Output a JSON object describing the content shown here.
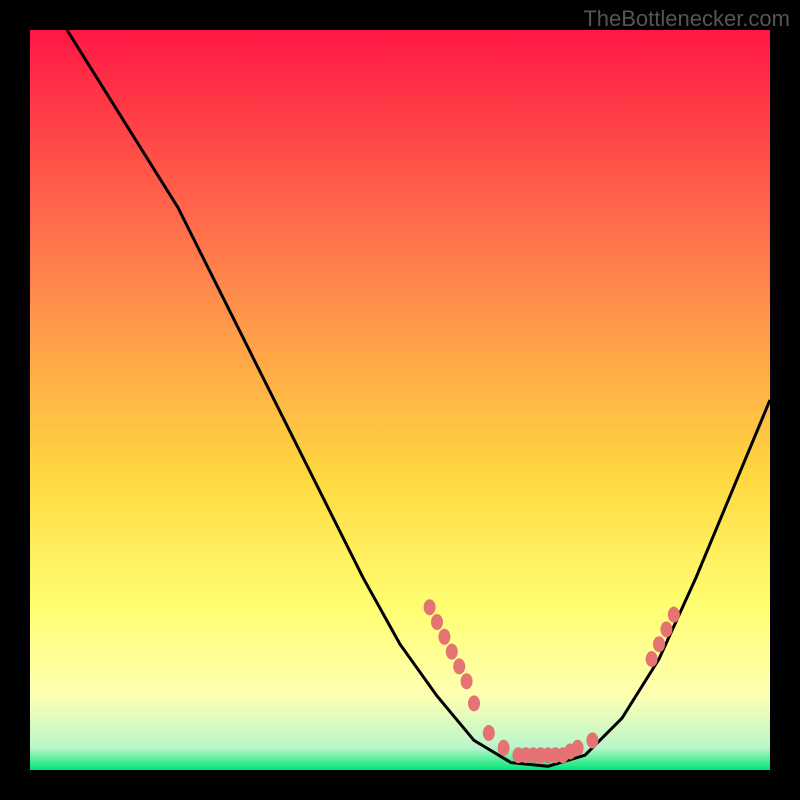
{
  "watermark": "TheBottlenecker.com",
  "chart_data": {
    "type": "line",
    "title": "",
    "xlabel": "",
    "ylabel": "",
    "xlim": [
      0,
      100
    ],
    "ylim": [
      0,
      100
    ],
    "gradient": {
      "top": "#ff1744",
      "mid_upper": "#ff8a65",
      "mid": "#ffeb3b",
      "mid_lower": "#ffff8d",
      "bottom": "#00e676"
    },
    "curve": [
      {
        "x": 5,
        "y": 100
      },
      {
        "x": 10,
        "y": 92
      },
      {
        "x": 15,
        "y": 84
      },
      {
        "x": 20,
        "y": 76
      },
      {
        "x": 25,
        "y": 66
      },
      {
        "x": 30,
        "y": 56
      },
      {
        "x": 35,
        "y": 46
      },
      {
        "x": 40,
        "y": 36
      },
      {
        "x": 45,
        "y": 26
      },
      {
        "x": 50,
        "y": 17
      },
      {
        "x": 55,
        "y": 10
      },
      {
        "x": 60,
        "y": 4
      },
      {
        "x": 65,
        "y": 1
      },
      {
        "x": 70,
        "y": 0.5
      },
      {
        "x": 75,
        "y": 2
      },
      {
        "x": 80,
        "y": 7
      },
      {
        "x": 85,
        "y": 15
      },
      {
        "x": 90,
        "y": 26
      },
      {
        "x": 95,
        "y": 38
      },
      {
        "x": 100,
        "y": 50
      }
    ],
    "marker_points": [
      {
        "x": 54,
        "y": 22
      },
      {
        "x": 55,
        "y": 20
      },
      {
        "x": 56,
        "y": 18
      },
      {
        "x": 57,
        "y": 16
      },
      {
        "x": 58,
        "y": 14
      },
      {
        "x": 59,
        "y": 12
      },
      {
        "x": 60,
        "y": 9
      },
      {
        "x": 62,
        "y": 5
      },
      {
        "x": 64,
        "y": 3
      },
      {
        "x": 66,
        "y": 2
      },
      {
        "x": 67,
        "y": 2
      },
      {
        "x": 68,
        "y": 2
      },
      {
        "x": 69,
        "y": 2
      },
      {
        "x": 70,
        "y": 2
      },
      {
        "x": 71,
        "y": 2
      },
      {
        "x": 72,
        "y": 2
      },
      {
        "x": 73,
        "y": 2.5
      },
      {
        "x": 74,
        "y": 3
      },
      {
        "x": 76,
        "y": 4
      },
      {
        "x": 84,
        "y": 15
      },
      {
        "x": 85,
        "y": 17
      },
      {
        "x": 86,
        "y": 19
      },
      {
        "x": 87,
        "y": 21
      }
    ],
    "marker_color": "#e57373",
    "curve_color": "#000000"
  }
}
